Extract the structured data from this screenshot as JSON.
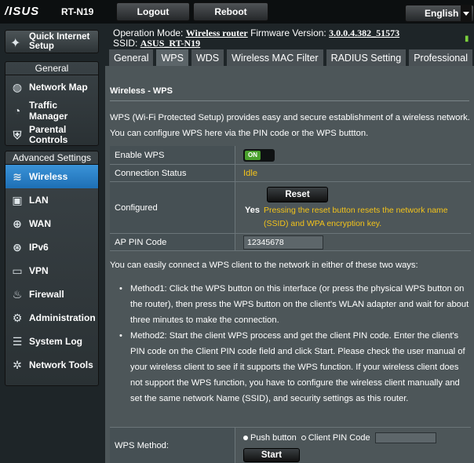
{
  "header": {
    "logo": "/ISUS",
    "model": "RT-N19",
    "logout_label": "Logout",
    "reboot_label": "Reboot",
    "language": "English"
  },
  "status": {
    "operation_mode_label": "Operation Mode:",
    "operation_mode_value": "Wireless router",
    "firmware_label": "Firmware Version:",
    "firmware_value": "3.0.0.4.382_51573",
    "ssid_label": "SSID:",
    "ssid_value": "ASUS_RT-N19"
  },
  "sidebar": {
    "quick_setup_label_1": "Quick Internet",
    "quick_setup_label_2": "Setup",
    "general_header": "General",
    "general_items": [
      {
        "label": "Network Map",
        "icon": "network-map-icon"
      },
      {
        "label": "Traffic Manager",
        "icon": "traffic-manager-icon"
      },
      {
        "label_1": "Parental",
        "label_2": "Controls",
        "icon": "parental-controls-icon"
      }
    ],
    "advanced_header": "Advanced Settings",
    "advanced_items": [
      {
        "label": "Wireless",
        "icon": "wireless-icon",
        "active": true
      },
      {
        "label": "LAN",
        "icon": "lan-icon"
      },
      {
        "label": "WAN",
        "icon": "wan-icon"
      },
      {
        "label": "IPv6",
        "icon": "ipv6-icon"
      },
      {
        "label": "VPN",
        "icon": "vpn-icon"
      },
      {
        "label": "Firewall",
        "icon": "firewall-icon"
      },
      {
        "label": "Administration",
        "icon": "administration-icon"
      },
      {
        "label": "System Log",
        "icon": "system-log-icon"
      },
      {
        "label": "Network Tools",
        "icon": "network-tools-icon"
      }
    ]
  },
  "tabs": [
    "General",
    "WPS",
    "WDS",
    "Wireless MAC Filter",
    "RADIUS Setting",
    "Professional"
  ],
  "active_tab": "WPS",
  "page": {
    "title": "Wireless - WPS",
    "description": "WPS (Wi-Fi Protected Setup) provides easy and secure establishment of a wireless network. You can configure WPS here via the PIN code or the WPS buttton."
  },
  "fields": {
    "enable_wps_label": "Enable WPS",
    "enable_wps_value": "ON",
    "connection_status_label": "Connection Status",
    "connection_status_value": "Idle",
    "configured_label": "Configured",
    "reset_label": "Reset",
    "configured_value": "Yes",
    "reset_note": "Pressing the reset button resets the network name (SSID) and WPA encryption key.",
    "ap_pin_label": "AP PIN Code",
    "ap_pin_value": "12345678"
  },
  "howto": {
    "intro": "You can easily connect a WPS client to the network in either of these two ways:",
    "method1": "Method1: Click the WPS button on this interface (or press the physical WPS button on the router), then press the WPS button on the client's WLAN adapter and wait for about three minutes to make the connection.",
    "method2": "Method2: Start the client WPS process and get the client PIN code. Enter the client's PIN code on the Client PIN code field and click Start. Please check the user manual of your wireless client to see if it supports the WPS function. If your wireless client does not support the WPS function, you have to configure the wireless client manually and set the same network Name (SSID), and security settings as this router."
  },
  "wps_method": {
    "label": "WPS Method:",
    "option_push": "Push button",
    "option_pin": "Client PIN Code",
    "selected": "Push button",
    "client_pin_value": "",
    "start_label": "Start"
  },
  "colors": {
    "background": "#1e2528",
    "panel": "#4d5659",
    "accent_active": "#2a82c9",
    "status_yellow": "#f3c31a",
    "toggle_on": "#4aa02c"
  }
}
